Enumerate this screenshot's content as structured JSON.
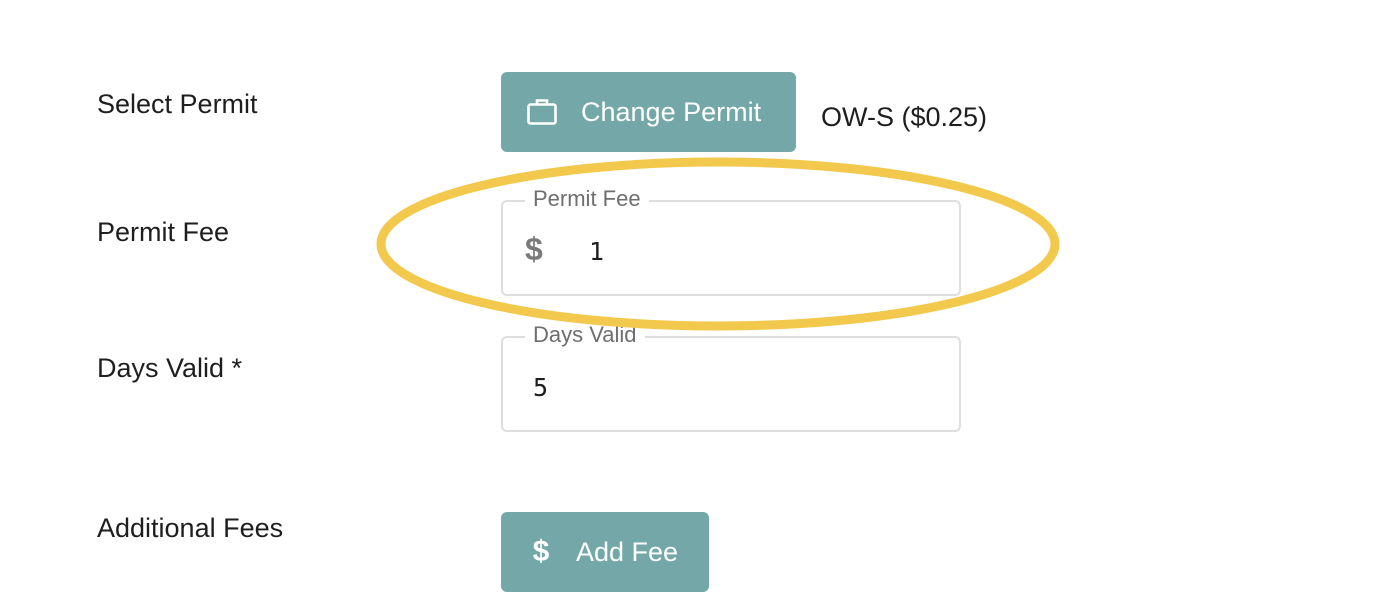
{
  "form": {
    "select_permit": {
      "label": "Select Permit",
      "button_label": "Change Permit",
      "button_icon": "briefcase-icon",
      "selected_value": "OW-S ($0.25)"
    },
    "permit_fee": {
      "label": "Permit Fee",
      "field_legend": "Permit Fee",
      "prefix": "$",
      "value": "1"
    },
    "days_valid": {
      "label": "Days Valid *",
      "field_legend": "Days Valid",
      "value": "5"
    },
    "additional_fees": {
      "label": "Additional Fees",
      "button_label": "Add Fee",
      "button_icon": "dollar-icon"
    }
  },
  "colors": {
    "button_bg": "#74a8a8",
    "highlight": "#f2c94c",
    "field_border": "#dedede"
  }
}
